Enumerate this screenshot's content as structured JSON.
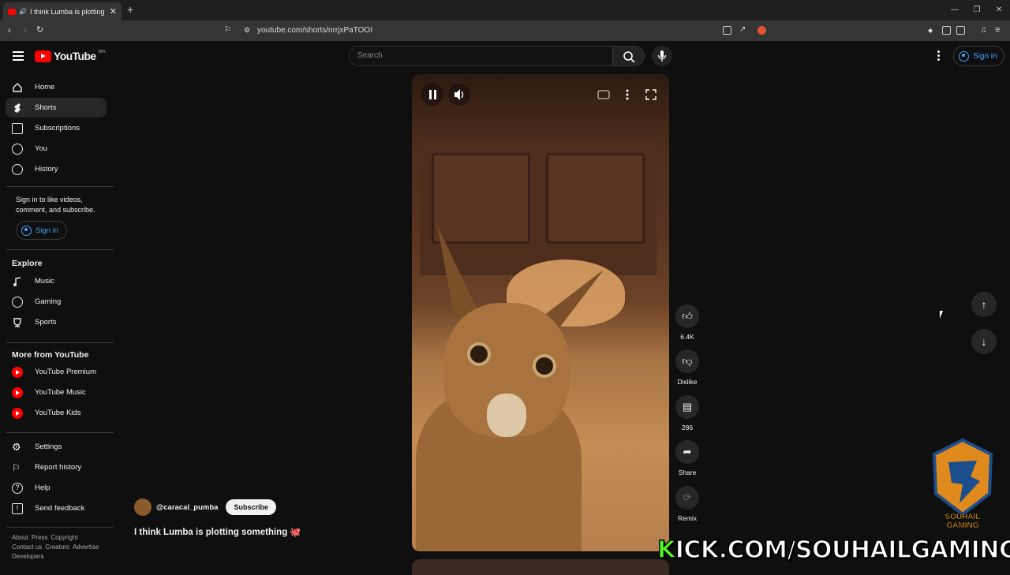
{
  "browser": {
    "tab_title": "I think Lumba is plotting som",
    "url": "youtube.com/shorts/nrrjxPaTOOI"
  },
  "header": {
    "logo_text": "YouTube",
    "country_code": "MA",
    "search_placeholder": "Search",
    "signin_label": "Sign in"
  },
  "sidebar": {
    "main": [
      {
        "label": "Home",
        "icon": "home-icon"
      },
      {
        "label": "Shorts",
        "icon": "shorts-icon"
      },
      {
        "label": "Subscriptions",
        "icon": "subscriptions-icon"
      },
      {
        "label": "You",
        "icon": "you-icon"
      },
      {
        "label": "History",
        "icon": "history-icon"
      }
    ],
    "signin_note": "Sign in to like videos, comment, and subscribe.",
    "signin_label": "Sign in",
    "explore_title": "Explore",
    "explore": [
      {
        "label": "Music",
        "icon": "music-icon"
      },
      {
        "label": "Gaming",
        "icon": "gaming-icon"
      },
      {
        "label": "Sports",
        "icon": "sports-icon"
      }
    ],
    "more_title": "More from YouTube",
    "more": [
      {
        "label": "YouTube Premium",
        "icon": "youtube-premium-icon"
      },
      {
        "label": "YouTube Music",
        "icon": "youtube-music-icon"
      },
      {
        "label": "YouTube Kids",
        "icon": "youtube-kids-icon"
      }
    ],
    "settings": [
      {
        "label": "Settings",
        "icon": "gear-icon"
      },
      {
        "label": "Report history",
        "icon": "flag-icon"
      },
      {
        "label": "Help",
        "icon": "help-icon"
      },
      {
        "label": "Send feedback",
        "icon": "feedback-icon"
      }
    ],
    "footer_line1": [
      "About",
      "Press",
      "Copyright"
    ],
    "footer_line2": [
      "Contact us",
      "Creators",
      "Advertise"
    ],
    "footer_line3": [
      "Developers"
    ]
  },
  "short": {
    "channel": "@caracal_pumba",
    "subscribe_label": "Subscribe",
    "title": "I think Lumba is plotting something 🐙",
    "likes": "6.4K",
    "dislike_label": "Dislike",
    "comments": "286",
    "share_label": "Share",
    "remix_label": "Remix"
  },
  "overlay": {
    "kick_prefix": "K",
    "kick_text": "ICK.COM/SOUHAILGAMING",
    "logo_text": "SOUHAIL GAMING"
  },
  "colors": {
    "background": "#0f0f0f",
    "youtube_red": "#ff0000",
    "link_blue": "#3ea6ff",
    "kick_green": "#53fc18"
  }
}
